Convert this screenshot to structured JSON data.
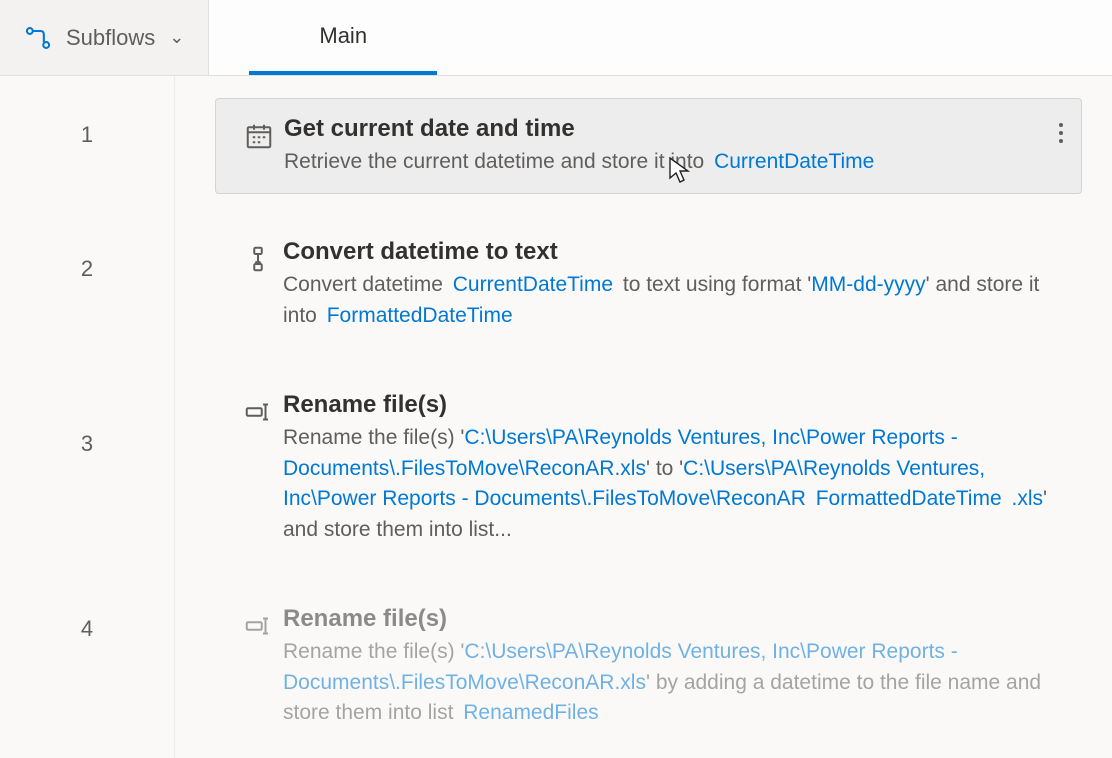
{
  "header": {
    "subflows_label": "Subflows",
    "tabs": [
      {
        "label": "Main",
        "active": true
      }
    ]
  },
  "actions": [
    {
      "line": "1",
      "selected": true,
      "disabled": false,
      "title": "Get current date and time",
      "desc_prefix": "Retrieve the current datetime and store it into ",
      "var1": "CurrentDateTime",
      "i": 0
    },
    {
      "line": "2",
      "selected": false,
      "disabled": false,
      "title": "Convert datetime to text",
      "desc_prefix": "Convert datetime ",
      "var1": "CurrentDateTime",
      "desc_mid1": " to text using format '",
      "lit1": "MM-dd-yyyy",
      "desc_mid2": "' and store it into ",
      "var2": "FormattedDateTime",
      "i": 1
    },
    {
      "line": "3",
      "selected": false,
      "disabled": false,
      "title": "Rename file(s)",
      "desc_prefix": "Rename the file(s) '",
      "lit1": "C:\\Users\\PA\\Reynolds Ventures, Inc\\Power Reports - Documents\\.FilesToMove\\ReconAR.xls",
      "desc_mid1": "' to '",
      "lit2": "C:\\Users\\PA\\Reynolds Ventures, Inc\\Power Reports - Documents\\.FilesToMove\\ReconAR ",
      "var1": "FormattedDateTime",
      "lit3": " .xls",
      "desc_suffix": "' and store them into list...",
      "i": 2
    },
    {
      "line": "4",
      "selected": false,
      "disabled": true,
      "title": "Rename file(s)",
      "desc_prefix": "Rename the file(s) '",
      "lit1": "C:\\Users\\PA\\Reynolds Ventures, Inc\\Power Reports - Documents\\.FilesToMove\\ReconAR.xls",
      "desc_mid1": "' by adding a datetime to the file name and store them into list ",
      "var1": "RenamedFiles",
      "i": 3
    }
  ]
}
